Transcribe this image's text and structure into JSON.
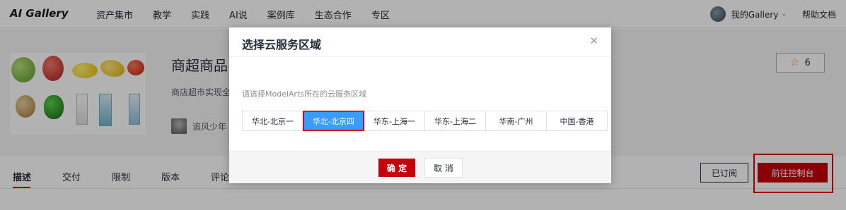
{
  "header": {
    "logo": "AI Gallery",
    "nav": [
      "资产集市",
      "教学",
      "实践",
      "AI说",
      "案例库",
      "生态合作",
      "专区"
    ],
    "user_label": "我的Gallery",
    "help": "帮助文档"
  },
  "product": {
    "title_partial": "商超商品",
    "desc_partial": "商店超市实现全",
    "author_partial": "追风少年",
    "star_count": "6"
  },
  "tabs": {
    "items": [
      "描述",
      "交付",
      "限制",
      "版本",
      "评论"
    ],
    "subscribed": "已订阅",
    "console": "前往控制台"
  },
  "modal": {
    "title": "选择云服务区域",
    "hint": "请选择ModelArts所在的云服务区域",
    "regions": [
      "华北-北京一",
      "华北-北京四",
      "华东-上海一",
      "华东-上海二",
      "华南-广州",
      "中国-香港"
    ],
    "selected_index": 1,
    "confirm": "确 定",
    "cancel": "取 消"
  },
  "colors": {
    "brand_red": "#c7000b",
    "selected_blue": "#3b9cff",
    "highlight_red": "#e3000f"
  }
}
